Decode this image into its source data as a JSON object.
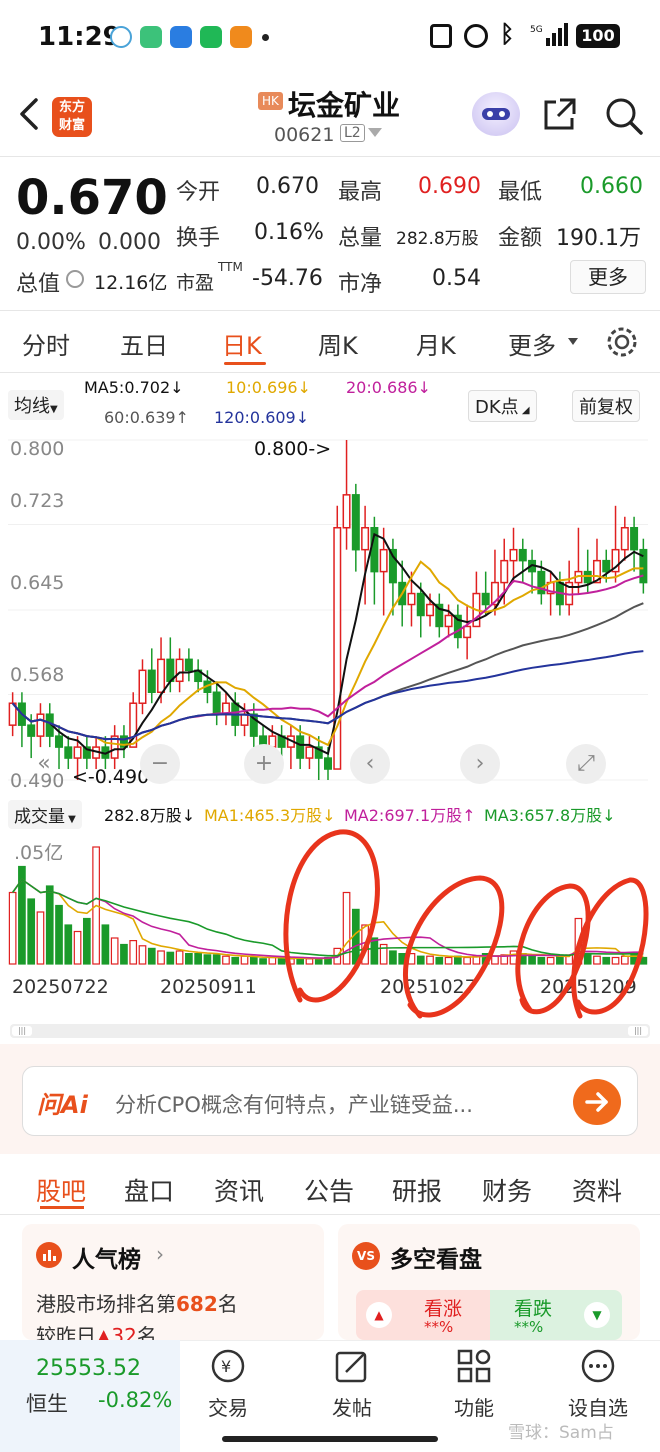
{
  "status": {
    "time": "11:29",
    "battery": "100"
  },
  "header": {
    "logo": [
      "东方",
      "财富"
    ],
    "market_badge": "HK",
    "title": "坛金矿业",
    "code": "00621",
    "level": "L2"
  },
  "quote": {
    "price": "0.670",
    "change_pct": "0.00%",
    "change": "0.000",
    "open_label": "今开",
    "open": "0.670",
    "high_label": "最高",
    "high": "0.690",
    "low_label": "最低",
    "low": "0.660",
    "turnover_label": "换手",
    "turnover": "0.16%",
    "volume_label": "总量",
    "volume": "282.8万股",
    "amount_label": "金额",
    "amount": "190.1万",
    "mktcap_label": "总值",
    "mktcap": "12.16亿",
    "pe_label": "市盈",
    "pe_sup": "TTM",
    "pe": "-54.76",
    "pb_label": "市净",
    "pb": "0.54",
    "more": "更多"
  },
  "tabs": [
    "分时",
    "五日",
    "日K",
    "周K",
    "月K",
    "更多"
  ],
  "active_tab": "日K",
  "ma": {
    "selector": "均线",
    "ma5": "MA5:0.702↓",
    "ma10": "10:0.696↓",
    "ma20": "20:0.686↓",
    "ma60": "60:0.639↑",
    "ma120": "120:0.609↓",
    "dk": "DK点",
    "adjust": "前复权",
    "colors": {
      "ma5": "#111111",
      "ma10": "#e0a800",
      "ma20": "#c0209c",
      "ma60": "#555555",
      "ma120": "#24349c"
    }
  },
  "kchart": {
    "y_ticks": [
      "0.800",
      "0.723",
      "0.645",
      "0.568",
      "0.490"
    ],
    "max_marker": "0.800->",
    "min_marker": "<-0.490",
    "candles": [
      [
        0.54,
        0.56,
        0.57,
        0.53
      ],
      [
        0.56,
        0.54,
        0.57,
        0.52
      ],
      [
        0.54,
        0.53,
        0.55,
        0.51
      ],
      [
        0.53,
        0.55,
        0.56,
        0.52
      ],
      [
        0.55,
        0.53,
        0.56,
        0.52
      ],
      [
        0.53,
        0.52,
        0.54,
        0.5
      ],
      [
        0.52,
        0.51,
        0.53,
        0.5
      ],
      [
        0.51,
        0.52,
        0.53,
        0.49
      ],
      [
        0.52,
        0.51,
        0.53,
        0.5
      ],
      [
        0.51,
        0.52,
        0.53,
        0.5
      ],
      [
        0.52,
        0.51,
        0.53,
        0.5
      ],
      [
        0.51,
        0.53,
        0.54,
        0.5
      ],
      [
        0.53,
        0.52,
        0.54,
        0.51
      ],
      [
        0.52,
        0.56,
        0.57,
        0.52
      ],
      [
        0.56,
        0.59,
        0.6,
        0.55
      ],
      [
        0.59,
        0.57,
        0.61,
        0.56
      ],
      [
        0.57,
        0.6,
        0.62,
        0.56
      ],
      [
        0.6,
        0.58,
        0.62,
        0.57
      ],
      [
        0.58,
        0.6,
        0.61,
        0.57
      ],
      [
        0.6,
        0.59,
        0.61,
        0.58
      ],
      [
        0.59,
        0.58,
        0.6,
        0.57
      ],
      [
        0.58,
        0.57,
        0.59,
        0.56
      ],
      [
        0.57,
        0.55,
        0.58,
        0.54
      ],
      [
        0.55,
        0.56,
        0.57,
        0.54
      ],
      [
        0.56,
        0.54,
        0.57,
        0.53
      ],
      [
        0.54,
        0.55,
        0.56,
        0.53
      ],
      [
        0.55,
        0.53,
        0.56,
        0.52
      ],
      [
        0.53,
        0.52,
        0.54,
        0.51
      ],
      [
        0.52,
        0.53,
        0.54,
        0.51
      ],
      [
        0.53,
        0.52,
        0.54,
        0.51
      ],
      [
        0.52,
        0.53,
        0.54,
        0.5
      ],
      [
        0.53,
        0.51,
        0.54,
        0.5
      ],
      [
        0.51,
        0.52,
        0.53,
        0.5
      ],
      [
        0.52,
        0.51,
        0.53,
        0.49
      ],
      [
        0.51,
        0.5,
        0.52,
        0.49
      ],
      [
        0.5,
        0.72,
        0.74,
        0.5
      ],
      [
        0.72,
        0.75,
        0.8,
        0.7
      ],
      [
        0.75,
        0.7,
        0.76,
        0.68
      ],
      [
        0.7,
        0.72,
        0.74,
        0.65
      ],
      [
        0.72,
        0.68,
        0.73,
        0.65
      ],
      [
        0.68,
        0.7,
        0.72,
        0.64
      ],
      [
        0.7,
        0.67,
        0.71,
        0.64
      ],
      [
        0.67,
        0.65,
        0.69,
        0.63
      ],
      [
        0.65,
        0.66,
        0.68,
        0.63
      ],
      [
        0.66,
        0.64,
        0.67,
        0.62
      ],
      [
        0.64,
        0.65,
        0.66,
        0.63
      ],
      [
        0.65,
        0.63,
        0.66,
        0.62
      ],
      [
        0.63,
        0.64,
        0.65,
        0.62
      ],
      [
        0.64,
        0.62,
        0.65,
        0.61
      ],
      [
        0.62,
        0.63,
        0.65,
        0.6
      ],
      [
        0.63,
        0.66,
        0.68,
        0.63
      ],
      [
        0.66,
        0.65,
        0.68,
        0.64
      ],
      [
        0.65,
        0.67,
        0.7,
        0.64
      ],
      [
        0.67,
        0.69,
        0.71,
        0.65
      ],
      [
        0.69,
        0.7,
        0.72,
        0.67
      ],
      [
        0.7,
        0.69,
        0.71,
        0.67
      ],
      [
        0.69,
        0.68,
        0.7,
        0.66
      ],
      [
        0.68,
        0.66,
        0.69,
        0.65
      ],
      [
        0.66,
        0.67,
        0.68,
        0.64
      ],
      [
        0.67,
        0.65,
        0.68,
        0.64
      ],
      [
        0.65,
        0.67,
        0.69,
        0.64
      ],
      [
        0.67,
        0.68,
        0.72,
        0.66
      ],
      [
        0.68,
        0.67,
        0.7,
        0.66
      ],
      [
        0.67,
        0.69,
        0.71,
        0.67
      ],
      [
        0.69,
        0.68,
        0.7,
        0.67
      ],
      [
        0.68,
        0.7,
        0.74,
        0.67
      ],
      [
        0.7,
        0.72,
        0.73,
        0.69
      ],
      [
        0.72,
        0.7,
        0.73,
        0.68
      ],
      [
        0.7,
        0.67,
        0.71,
        0.66
      ]
    ]
  },
  "chart_controls": [
    "«",
    "−",
    "+",
    "‹",
    "›",
    "⤢"
  ],
  "volume": {
    "selector": "成交量",
    "total": "282.8万股↓",
    "ma1": "MA1:465.3万股↓",
    "ma2": "MA2:697.1万股↑",
    "ma3": "MA3:657.8万股↓",
    "top_label": ".05亿",
    "bars": [
      0.55,
      0.75,
      0.5,
      0.4,
      0.6,
      0.45,
      0.3,
      0.25,
      0.35,
      0.9,
      0.3,
      0.2,
      0.15,
      0.18,
      0.14,
      0.12,
      0.1,
      0.09,
      0.1,
      0.08,
      0.08,
      0.07,
      0.07,
      0.06,
      0.05,
      0.06,
      0.05,
      0.04,
      0.05,
      0.04,
      0.04,
      0.05,
      0.04,
      0.04,
      0.05,
      0.12,
      0.55,
      0.42,
      0.3,
      0.2,
      0.15,
      0.1,
      0.08,
      0.08,
      0.06,
      0.06,
      0.05,
      0.05,
      0.06,
      0.05,
      0.06,
      0.08,
      0.06,
      0.07,
      0.1,
      0.08,
      0.06,
      0.05,
      0.05,
      0.06,
      0.07,
      0.35,
      0.08,
      0.06,
      0.05,
      0.05,
      0.06,
      0.08,
      0.05
    ],
    "dates": [
      "20250722",
      "20250911",
      "20251027",
      "20251209"
    ]
  },
  "ai": {
    "brand": "问Ai",
    "placeholder": "分析CPO概念有何特点，产业链受益..."
  },
  "subtabs": [
    "股吧",
    "盘口",
    "资讯",
    "公告",
    "研报",
    "财务",
    "资料"
  ],
  "active_subtab": "股吧",
  "popularity": {
    "title": "人气榜",
    "rank_prefix": "港股市场排名第",
    "rank": "682",
    "rank_suffix": "名",
    "change_prefix": "较昨日",
    "change": "32",
    "change_suffix": "名"
  },
  "sentiment": {
    "title": "多空看盘",
    "bull": "看涨",
    "bull_pct": "**%",
    "bear": "看跌",
    "bear_pct": "**%"
  },
  "bottom": {
    "index_value": "25553.52",
    "index_name": "恒生",
    "index_change": "-0.82%",
    "nav": [
      "交易",
      "发帖",
      "功能",
      "设自选"
    ]
  },
  "watermark": "雪球：Sam占"
}
